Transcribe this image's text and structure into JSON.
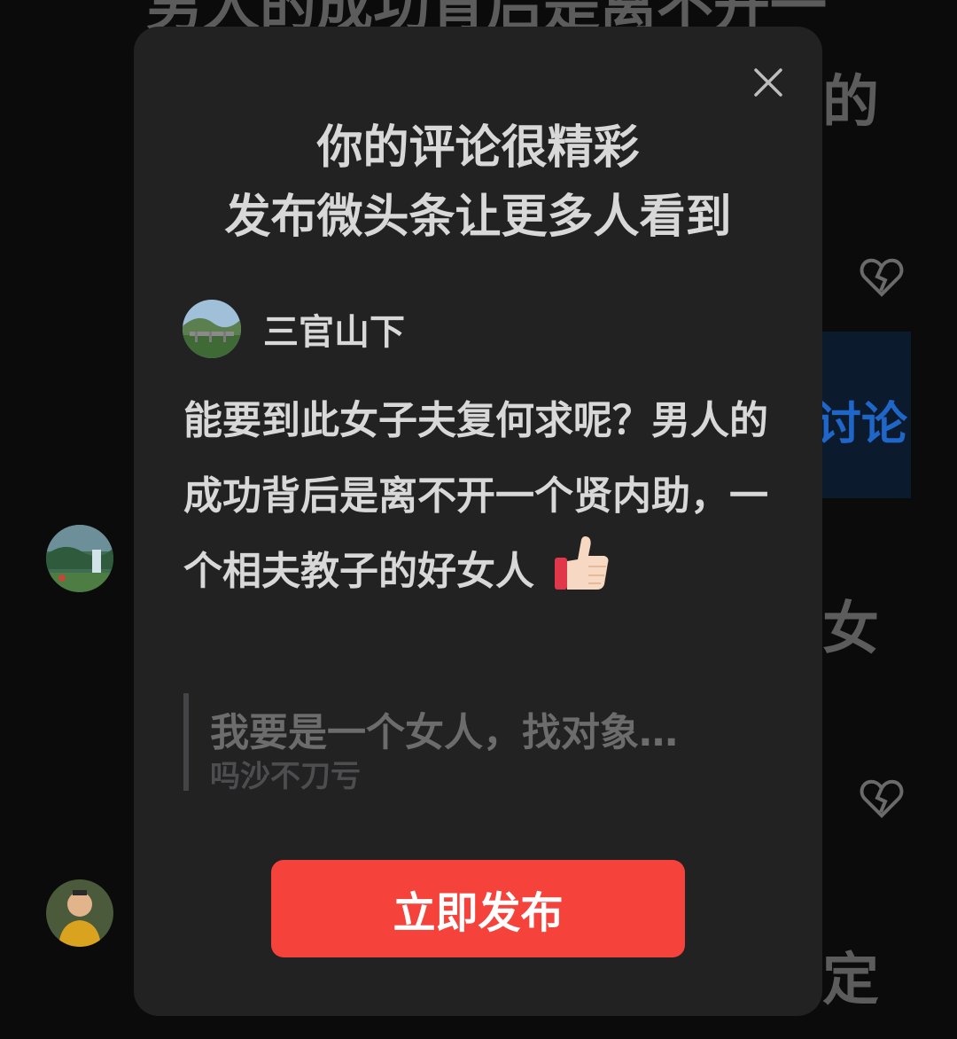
{
  "background": {
    "top_text": "男人的成功背后是离不开一",
    "line2_tail": "的",
    "discuss_link": "讨论",
    "line_nv": "女",
    "line_ding": "定"
  },
  "modal": {
    "title_line1": "你的评论很精彩",
    "title_line2": "发布微头条让更多人看到",
    "user": {
      "name": "三官山下"
    },
    "comment_text": "能要到此女子夫复何求呢？男人的成功背后是离不开一个贤内助，一个相夫教子的好女人",
    "comment_emoji": "thumbs-up",
    "quote": {
      "text": "我要是一个女人，找对象…",
      "author": "吗沙不刀亏"
    },
    "publish_label": "立即发布"
  },
  "colors": {
    "modal_bg": "#222223",
    "accent_button": "#f5423b",
    "link_blue": "#1f66c9"
  }
}
